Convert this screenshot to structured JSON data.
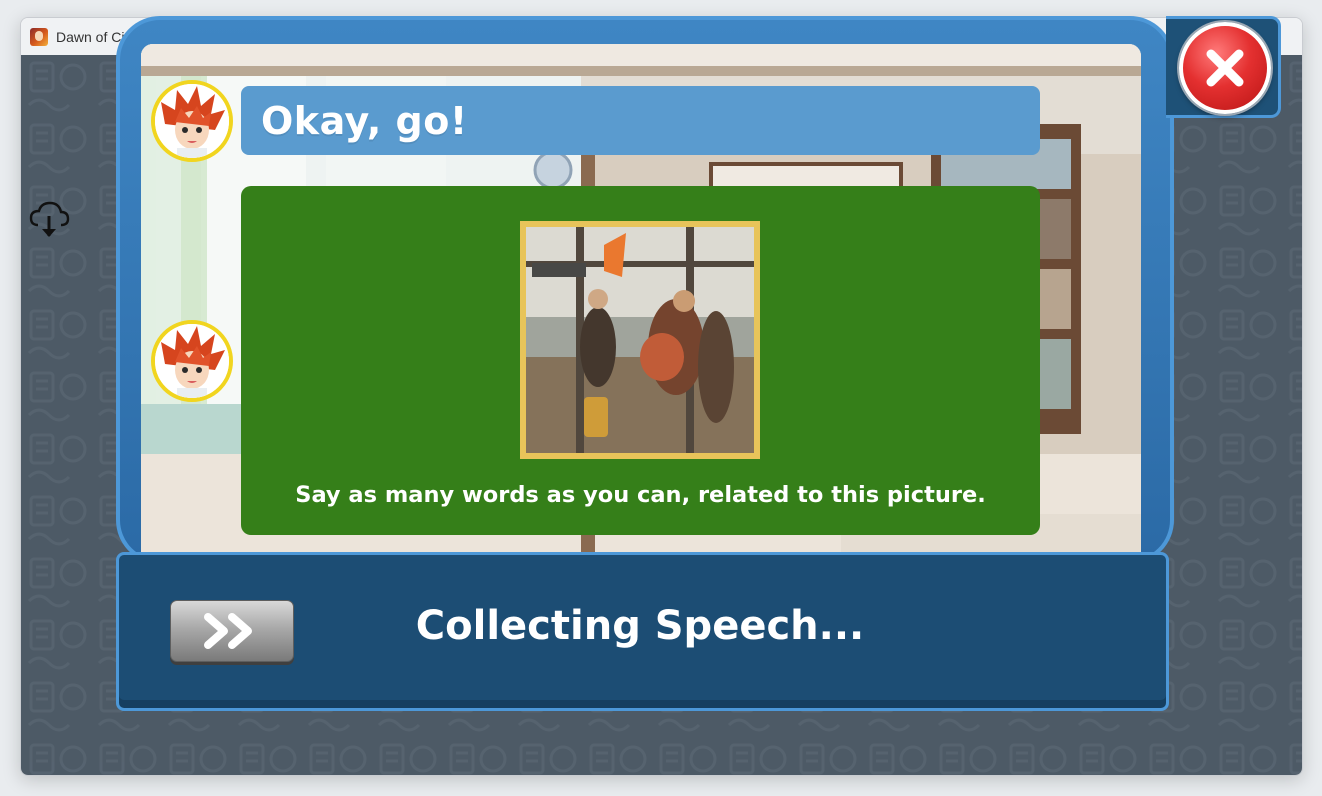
{
  "window": {
    "title": "Dawn of Civilization",
    "controls": [
      "minimize",
      "maximize",
      "close"
    ]
  },
  "icons": {
    "app": "app-icon",
    "cloud": "cloud-download-icon",
    "close": "close-x-icon",
    "next": "double-chevron-right-icon"
  },
  "dialog": {
    "speech": "Okay, go!",
    "task_instruction": "Say as many words as you can, related to this picture.",
    "photo_subject": "airport-travelers-photo"
  },
  "footer": {
    "status": "Collecting Speech..."
  },
  "colors": {
    "frame_blue": "#3f86c4",
    "speech_bubble": "#5a9bcf",
    "task_green": "#357f19",
    "footer_navy": "#1c4d74",
    "close_red": "#e43030",
    "avatar_ring": "#f1d51f"
  }
}
